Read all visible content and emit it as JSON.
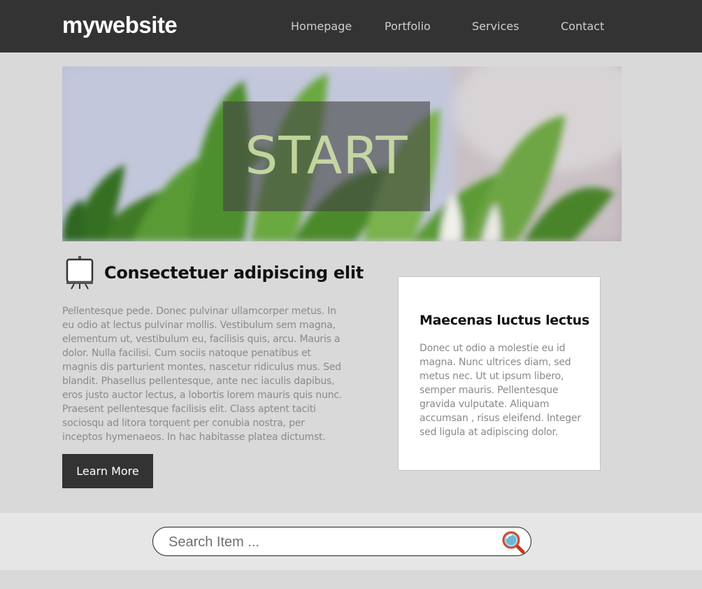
{
  "site": {
    "logo": "mywebsite"
  },
  "nav": {
    "items": [
      {
        "label": "Homepage"
      },
      {
        "label": "Portfolio"
      },
      {
        "label": "Services"
      },
      {
        "label": "Contact"
      }
    ]
  },
  "hero": {
    "text": "START"
  },
  "main": {
    "icon": "easel-icon",
    "heading": "Consectetuer adipiscing elit",
    "body": "Pellentesque pede. Donec pulvinar ullamcorper metus. In eu odio at lectus pulvinar mollis. Vestibulum sem magna, elementum ut, vestibulum eu, facilisis quis, arcu. Mauris a dolor. Nulla facilisi. Cum sociis natoque penatibus et magnis dis parturient montes, nascetur ridiculus mus. Sed blandit. Phasellus pellentesque, ante nec iaculis dapibus, eros justo auctor lectus, a lobortis lorem mauris quis nunc. Praesent pellentesque facilisis elit. Class aptent taciti sociosqu ad litora torquent per conubia nostra, per inceptos hymenaeos. In hac habitasse platea dictumst.",
    "button_label": "Learn More"
  },
  "sidebar": {
    "title": "Maecenas luctus lectus",
    "body": "Donec ut odio a molestie eu id magna. Nunc ultrices diam, sed metus nec. Ut ut ipsum libero, semper mauris. Pellentesque gravida vulputate. Aliquam accumsan , risus eleifend. Integer sed ligula at adipiscing dolor."
  },
  "search": {
    "placeholder": "Search Item ...",
    "value": "",
    "icon": "magnifier-icon"
  },
  "colors": {
    "header_bg": "#333333",
    "page_bg": "#d9d9d9",
    "button_bg": "#333333",
    "text_muted": "#8a8a8a"
  }
}
